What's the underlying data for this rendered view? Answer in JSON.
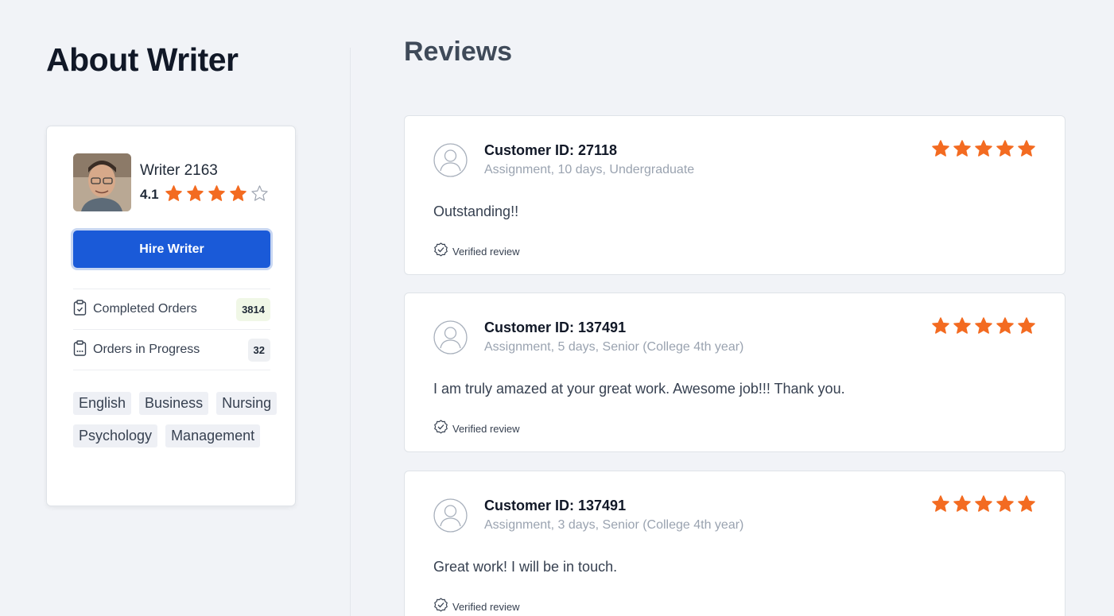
{
  "about": {
    "title": "About Writer"
  },
  "writer": {
    "name": "Writer 2163",
    "rating": "4.1",
    "rating_value": 4.1,
    "stars_filled": 4,
    "stars_total": 5,
    "hire_label": "Hire Writer",
    "stats": [
      {
        "label": "Completed Orders",
        "value": "3814",
        "icon": "clipboard-check-icon"
      },
      {
        "label": "Orders in Progress",
        "value": "32",
        "icon": "clipboard-progress-icon"
      }
    ],
    "tags": [
      "English",
      "Business",
      "Nursing",
      "Psychology",
      "Management"
    ]
  },
  "reviews": {
    "title": "Reviews",
    "items": [
      {
        "customer": "Customer ID: 27118",
        "meta": "Assignment, 10 days, Undergraduate",
        "text": "Outstanding!!",
        "verified": "Verified review",
        "stars": 5
      },
      {
        "customer": "Customer ID: 137491",
        "meta": "Assignment, 5 days, Senior (College 4th year)",
        "text": "I am truly amazed at your great work. Awesome job!!! Thank you.",
        "verified": "Verified review",
        "stars": 5
      },
      {
        "customer": "Customer ID: 137491",
        "meta": "Assignment, 3 days, Senior (College 4th year)",
        "text": "Great work! I will be in touch.",
        "verified": "Verified review",
        "stars": 5
      }
    ]
  },
  "colors": {
    "star": "#f36b21",
    "primary": "#1a5ad8",
    "background": "#f1f3f7"
  }
}
